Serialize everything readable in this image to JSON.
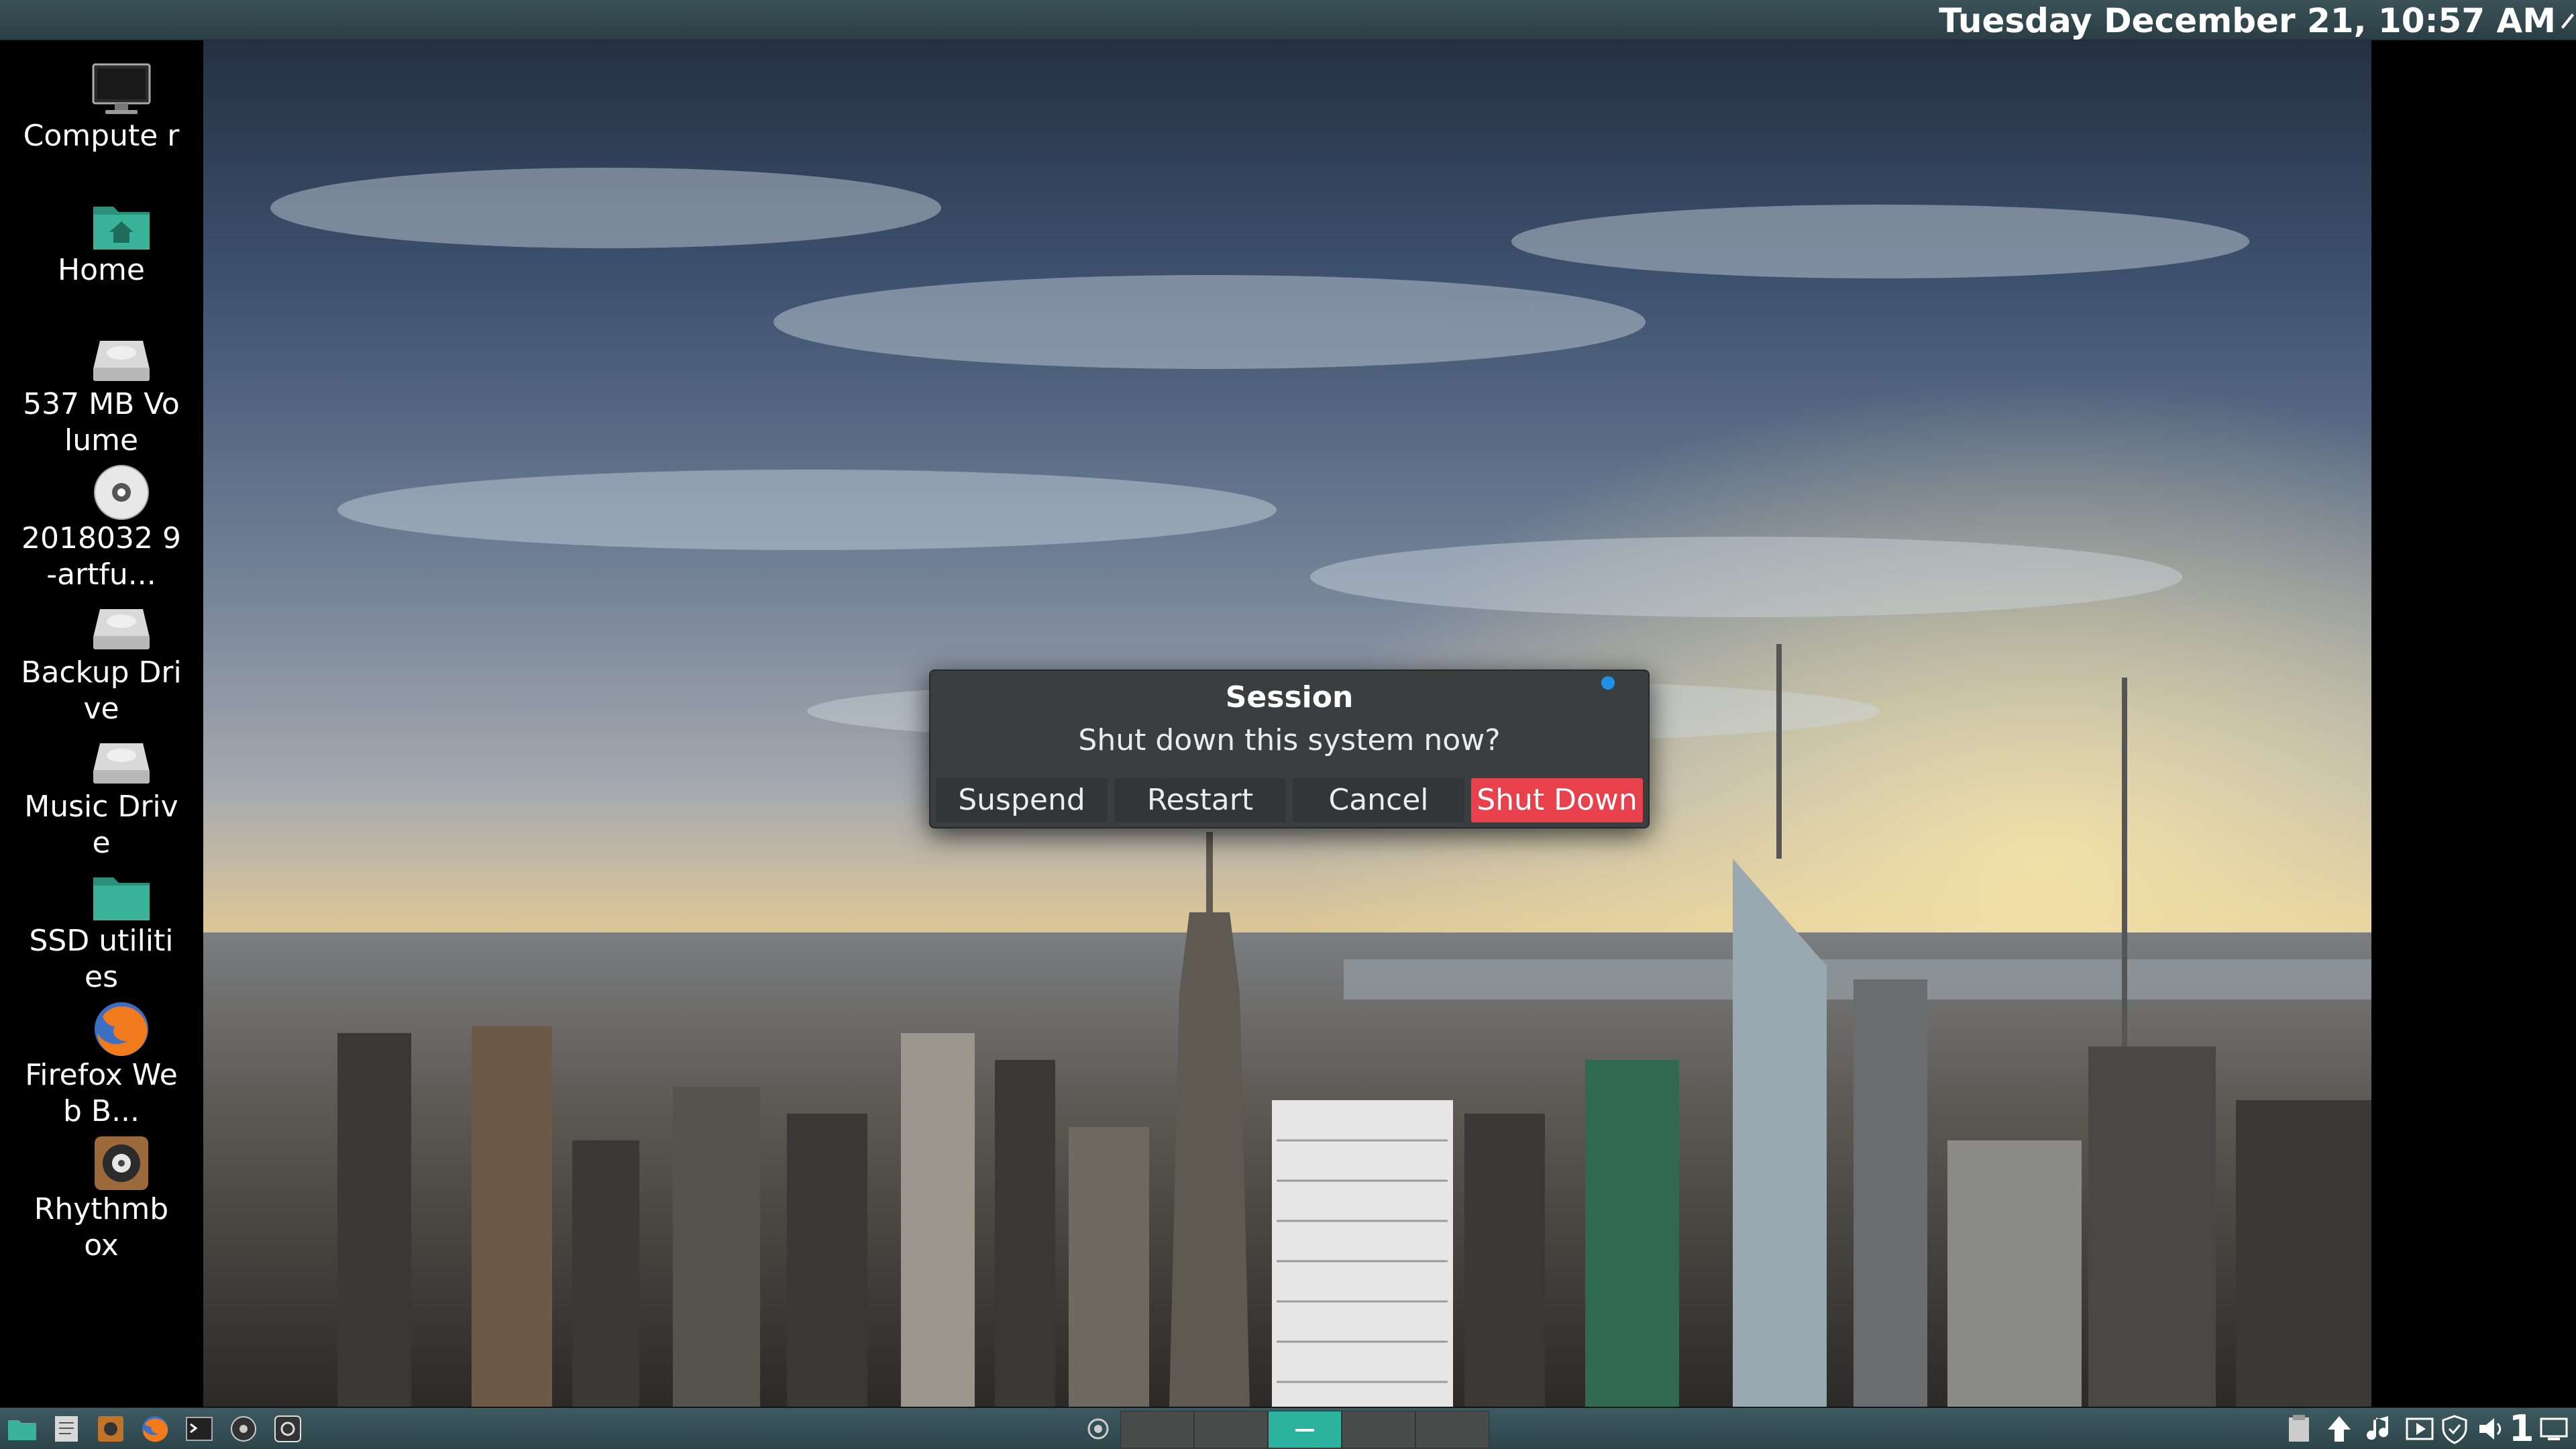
{
  "top_panel": {
    "clock": "Tuesday December 21, 10:57 AM"
  },
  "desktop_icons": [
    {
      "label": "Compute r",
      "icon": "computer-icon"
    },
    {
      "label": "Home",
      "icon": "home-folder-icon"
    },
    {
      "label": "537 MB Volume",
      "icon": "drive-icon"
    },
    {
      "label": "2018032 9-artfu...",
      "icon": "optical-disc-icon"
    },
    {
      "label": "Backup Drive",
      "icon": "drive-icon"
    },
    {
      "label": "Music Drive",
      "icon": "drive-icon"
    },
    {
      "label": "SSD utilities",
      "icon": "folder-icon"
    },
    {
      "label": "Firefox Web B...",
      "icon": "firefox-icon"
    },
    {
      "label": "Rhythmb ox",
      "icon": "rhythmbox-icon"
    }
  ],
  "dialog": {
    "title": "Session",
    "message": "Shut down this system now?",
    "buttons": {
      "suspend": "Suspend",
      "restart": "Restart",
      "cancel": "Cancel",
      "shutdown": "Shut Down"
    },
    "accent_color": "#e8414b"
  },
  "taskbar": {
    "launchers": [
      "file-manager-icon",
      "text-editor-icon",
      "disk-utility-icon",
      "firefox-icon",
      "terminal-icon",
      "disc-icon",
      "camera-icon"
    ],
    "workspace_number": "1"
  },
  "colors": {
    "panel": "#2f484d",
    "workspace_active": "#2bb3a0"
  }
}
